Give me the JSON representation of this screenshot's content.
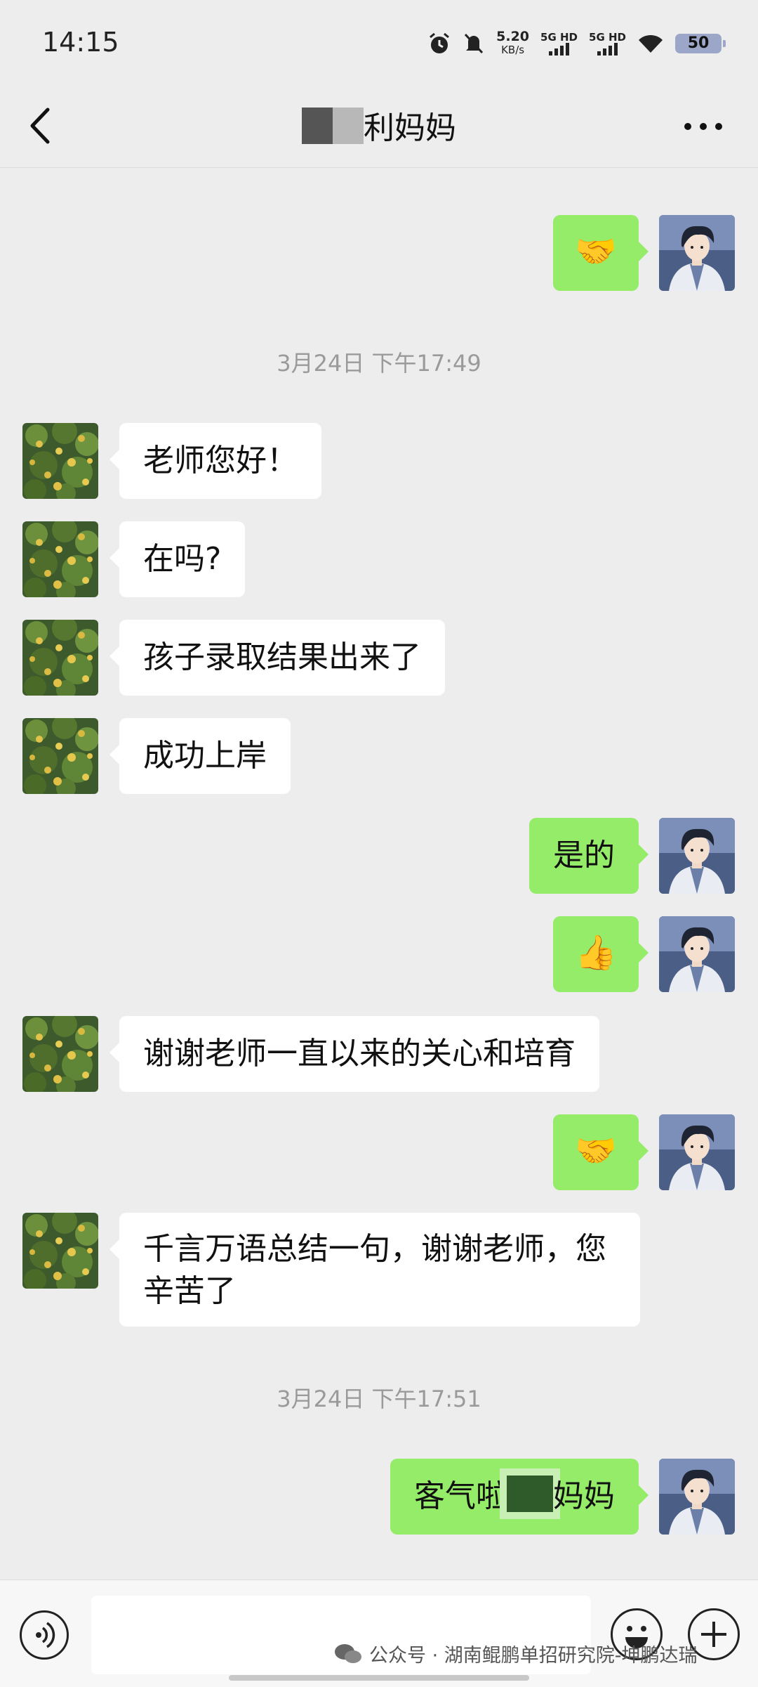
{
  "status_bar": {
    "time": "14:15",
    "speed_value": "5.20",
    "speed_unit": "KB/s",
    "sim1": "5G HD",
    "sim2": "5G HD",
    "battery": "50",
    "icons": [
      "alarm-icon",
      "mute-icon",
      "signal-icon",
      "wifi-icon",
      "battery-icon"
    ]
  },
  "header": {
    "title_suffix": "利妈妈",
    "back_icon": "chevron-left-icon",
    "more_icon": "more-dots-icon"
  },
  "messages": [
    {
      "side": "out",
      "type": "emoji",
      "content": "🤝"
    },
    {
      "type": "timestamp",
      "content": "3月24日 下午17:49"
    },
    {
      "side": "in",
      "type": "text",
      "content": "老师您好！"
    },
    {
      "side": "in",
      "type": "text",
      "content": "在吗?"
    },
    {
      "side": "in",
      "type": "text",
      "content": "孩子录取结果出来了"
    },
    {
      "side": "in",
      "type": "text",
      "content": "成功上岸"
    },
    {
      "side": "out",
      "type": "text",
      "content": "是的"
    },
    {
      "side": "out",
      "type": "emoji",
      "content": "👍"
    },
    {
      "side": "in",
      "type": "text",
      "content": "谢谢老师一直以来的关心和培育"
    },
    {
      "side": "out",
      "type": "emoji",
      "content": "🤝"
    },
    {
      "side": "in",
      "type": "text",
      "content": "千言万语总结一句，谢谢老师，您辛苦了"
    },
    {
      "type": "timestamp",
      "content": "3月24日 下午17:51"
    },
    {
      "side": "out",
      "type": "text",
      "content_prefix": "客气啦",
      "content_suffix": "妈妈"
    }
  ],
  "input_bar": {
    "voice_icon": "voice-icon",
    "emoji_icon": "smiley-icon",
    "plus_icon": "plus-icon"
  },
  "watermark": "公众号 · 湖南鲲鹏单招研究院-坤鹏达瑞",
  "colors": {
    "background": "#ededed",
    "outgoing_bubble": "#95ec69",
    "incoming_bubble": "#ffffff"
  }
}
